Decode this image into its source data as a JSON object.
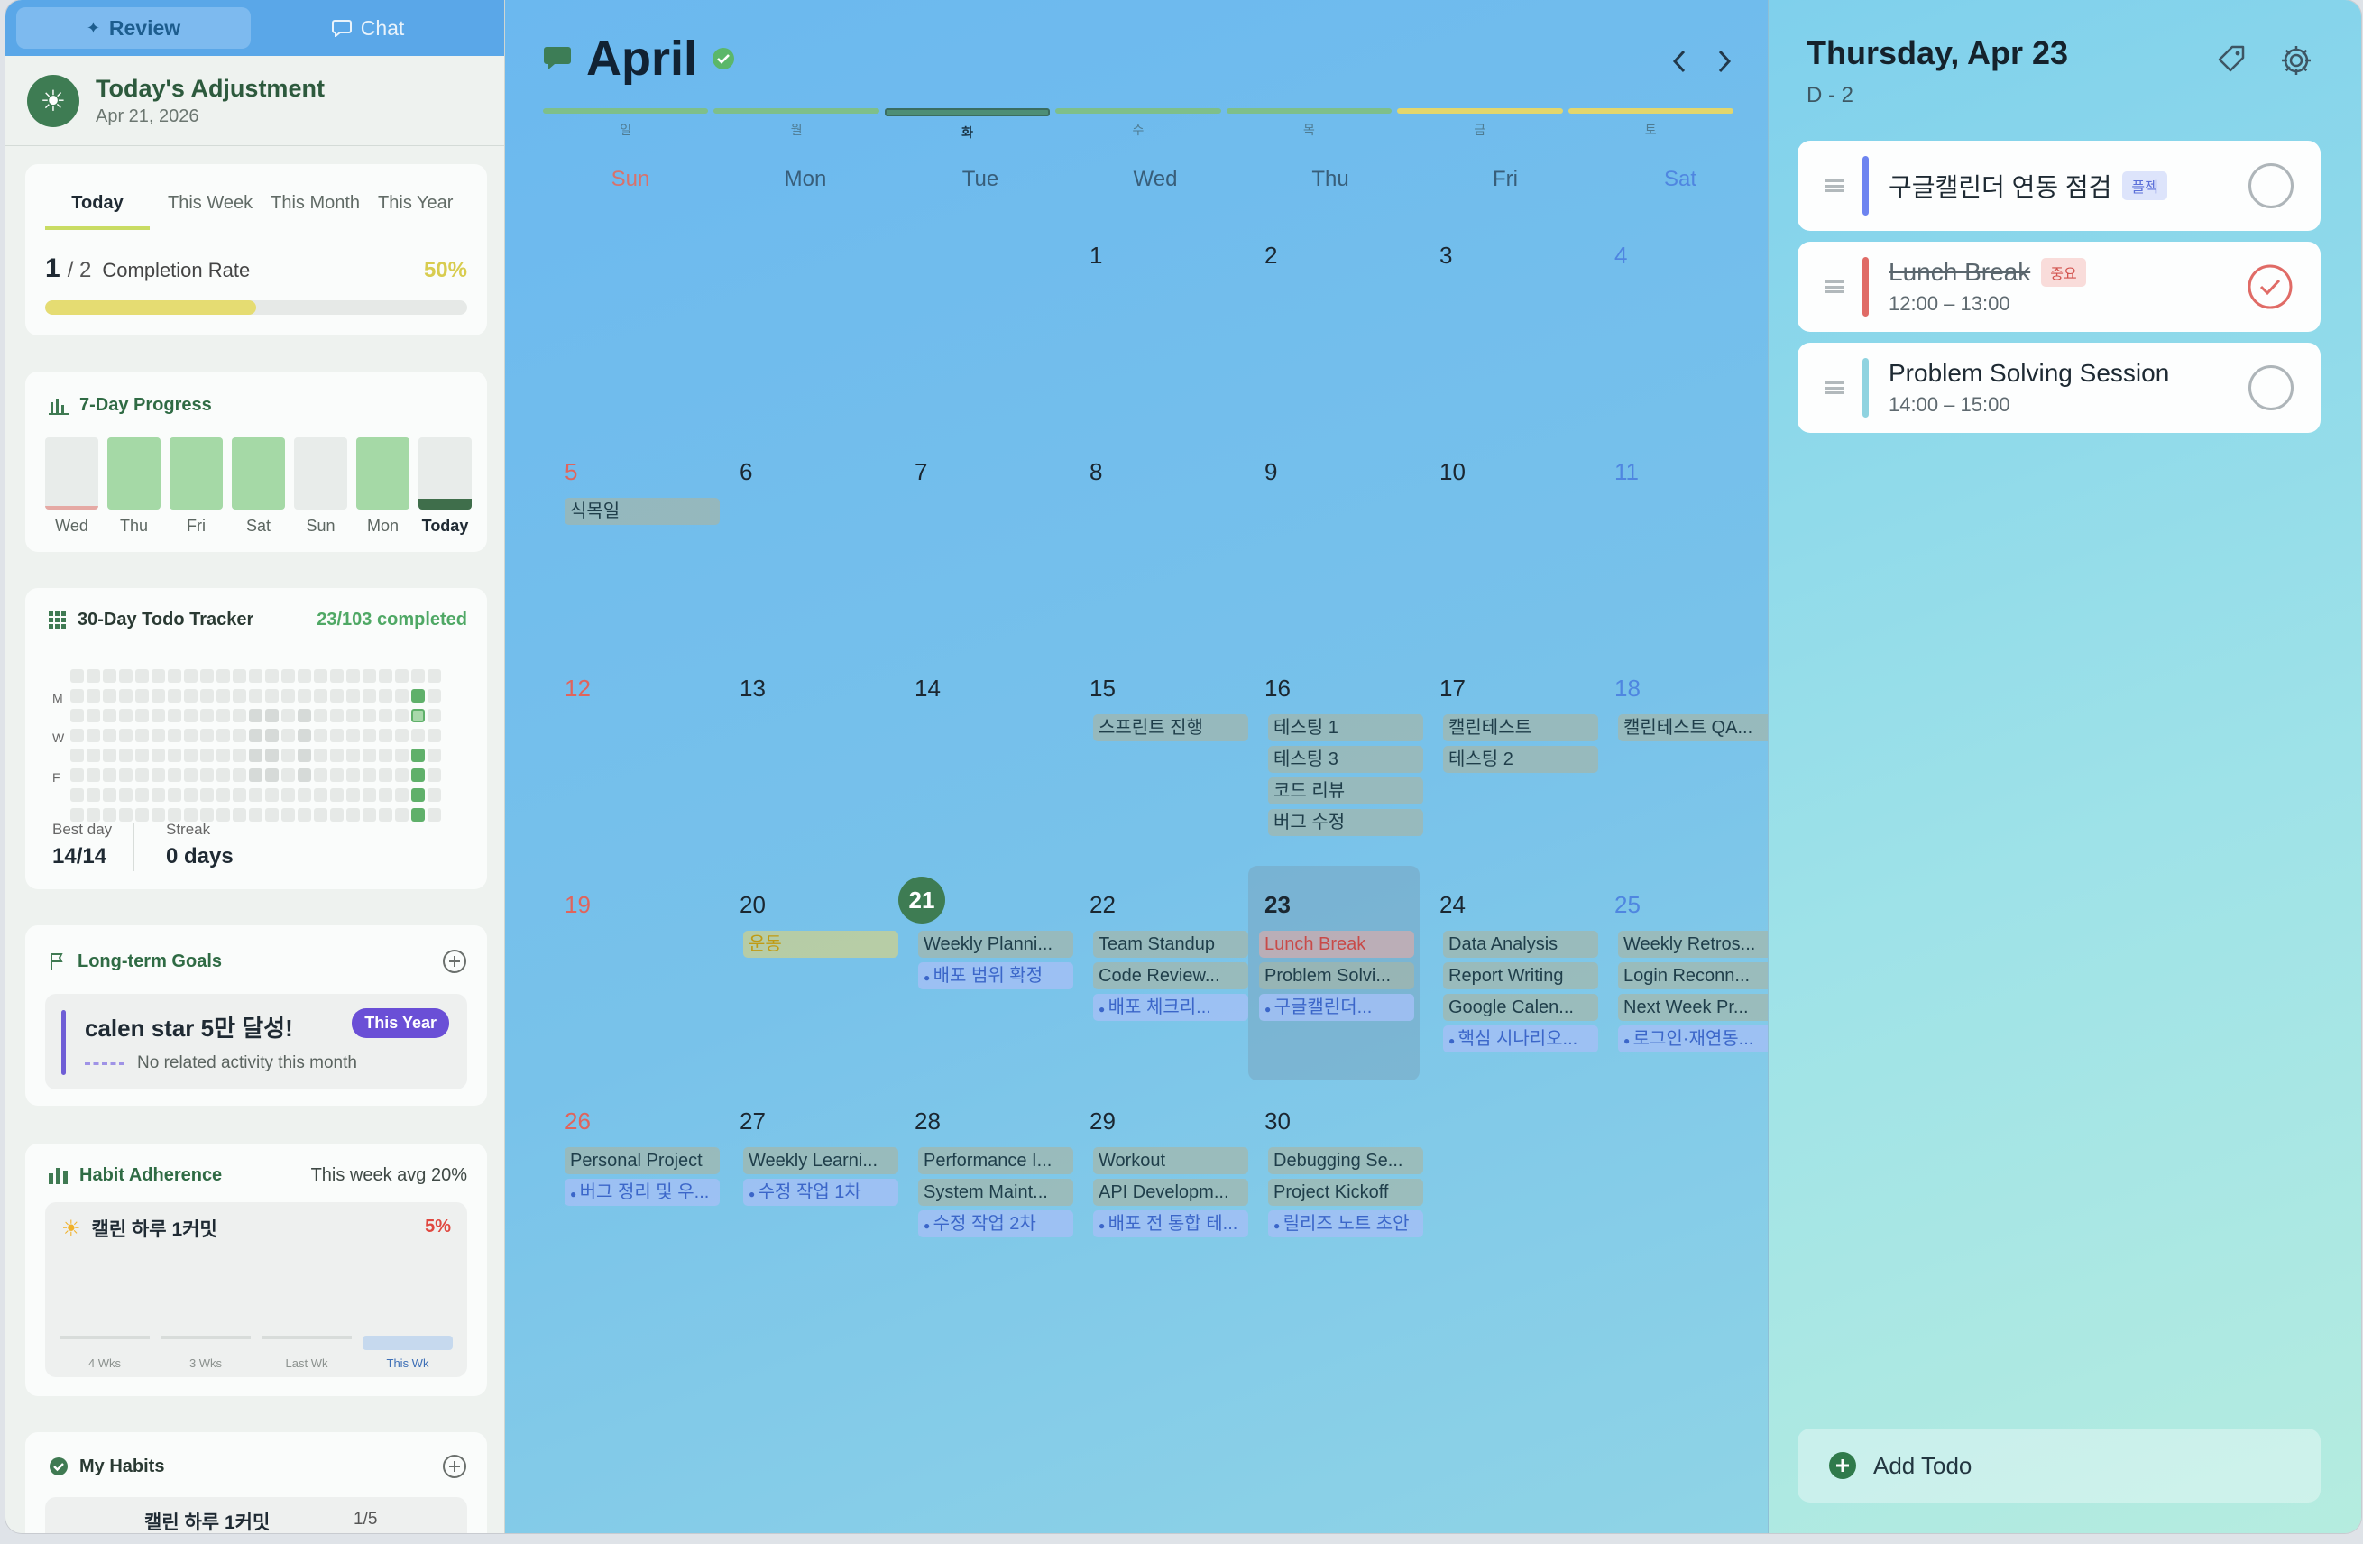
{
  "tabs": [
    {
      "label": "Review",
      "active": true
    },
    {
      "label": "Chat",
      "active": false
    }
  ],
  "adjustment": {
    "title": "Today's Adjustment",
    "date": "Apr 21, 2026"
  },
  "completion": {
    "periods": [
      "Today",
      "This Week",
      "This Month",
      "This Year"
    ],
    "selected": "Today",
    "done": "1",
    "sep": "/ 2",
    "label": "Completion Rate",
    "percent": "50%",
    "fraction": 0.5
  },
  "seven_day": {
    "title": "7-Day Progress",
    "days": [
      {
        "label": "Wed",
        "level": 0.05,
        "color": "#e5a9a4"
      },
      {
        "label": "Thu",
        "level": 1.0,
        "color": "#a5d9a6"
      },
      {
        "label": "Fri",
        "level": 1.0,
        "color": "#a5d9a6"
      },
      {
        "label": "Sat",
        "level": 1.0,
        "color": "#a5d9a6"
      },
      {
        "label": "Sun",
        "level": 0.0,
        "color": "#a5d9a6"
      },
      {
        "label": "Mon",
        "level": 1.0,
        "color": "#a5d9a6"
      },
      {
        "label": "Today",
        "level": 0.15,
        "color": "#3f6e4b"
      }
    ]
  },
  "tracker": {
    "title": "30-Day Todo Tracker",
    "summary": "23/103 completed",
    "row_labels": [
      "M",
      "W",
      "F"
    ],
    "best_day_label": "Best day",
    "best_day": "14/14",
    "streak_label": "Streak",
    "streak": "0 days"
  },
  "goals": {
    "title": "Long-term Goals",
    "item": {
      "name": "calen star 5만 달성!",
      "badge": "This Year",
      "note": "No related activity this month"
    }
  },
  "habit": {
    "title": "Habit Adherence",
    "avg": "This week avg 20%",
    "name": "캘린 하루 1커밋",
    "percent": "5%",
    "weeks": [
      "4 Wks",
      "3 Wks",
      "Last Wk",
      "This Wk"
    ]
  },
  "my_habits": {
    "title": "My Habits",
    "item": "캘린 하루 1커밋",
    "count": "1/5"
  },
  "calendar": {
    "month": "April",
    "week_strip": [
      "일",
      "월",
      "화",
      "수",
      "목",
      "금",
      "토"
    ],
    "dow": [
      "Sun",
      "Mon",
      "Tue",
      "Wed",
      "Thu",
      "Fri",
      "Sat"
    ],
    "weeks": [
      [
        null,
        null,
        null,
        {
          "d": "1"
        },
        {
          "d": "2"
        },
        {
          "d": "3"
        },
        {
          "d": "4"
        }
      ],
      [
        {
          "d": "5",
          "ev": [
            {
              "t": "식목일",
              "k": ""
            }
          ]
        },
        {
          "d": "6"
        },
        {
          "d": "7"
        },
        {
          "d": "8"
        },
        {
          "d": "9"
        },
        {
          "d": "10"
        },
        {
          "d": "11"
        }
      ],
      [
        {
          "d": "12"
        },
        {
          "d": "13"
        },
        {
          "d": "14"
        },
        {
          "d": "15",
          "ev": [
            {
              "t": "스프린트 진행",
              "k": ""
            }
          ]
        },
        {
          "d": "16",
          "ev": [
            {
              "t": "테스팅 1",
              "k": ""
            },
            {
              "t": "테스팅 3",
              "k": ""
            },
            {
              "t": "코드 리뷰",
              "k": ""
            },
            {
              "t": "버그 수정",
              "k": ""
            }
          ]
        },
        {
          "d": "17",
          "ev": [
            {
              "t": "캘린테스트",
              "k": ""
            },
            {
              "t": "테스팅 2",
              "k": ""
            }
          ]
        },
        {
          "d": "18",
          "ev": [
            {
              "t": "캘린테스트 QA...",
              "k": ""
            }
          ]
        }
      ],
      [
        {
          "d": "19"
        },
        {
          "d": "20",
          "ev": [
            {
              "t": "운동",
              "k": "yel"
            }
          ]
        },
        {
          "d": "21",
          "today": true,
          "ev": [
            {
              "t": "Weekly Planni...",
              "k": ""
            },
            {
              "t": "배포 범위 확정",
              "k": "sub"
            }
          ]
        },
        {
          "d": "22",
          "ev": [
            {
              "t": "Team Standup",
              "k": ""
            },
            {
              "t": "Code Review...",
              "k": ""
            },
            {
              "t": "배포 체크리...",
              "k": "sub"
            }
          ]
        },
        {
          "d": "23",
          "sel": true,
          "ev": [
            {
              "t": "Lunch Break",
              "k": "red"
            },
            {
              "t": "Problem Solvi...",
              "k": ""
            },
            {
              "t": "구글캘린더...",
              "k": "sub"
            }
          ]
        },
        {
          "d": "24",
          "ev": [
            {
              "t": "Data Analysis",
              "k": ""
            },
            {
              "t": "Report Writing",
              "k": ""
            },
            {
              "t": "Google Calen...",
              "k": ""
            },
            {
              "t": "핵심 시나리오...",
              "k": "sub"
            }
          ]
        },
        {
          "d": "25",
          "ev": [
            {
              "t": "Weekly Retros...",
              "k": ""
            },
            {
              "t": "Login Reconn...",
              "k": ""
            },
            {
              "t": "Next Week Pr...",
              "k": ""
            },
            {
              "t": "로그인·재연동...",
              "k": "sub"
            }
          ]
        }
      ],
      [
        {
          "d": "26",
          "ev": [
            {
              "t": "Personal Project",
              "k": ""
            },
            {
              "t": "버그 정리 및 우...",
              "k": "sub"
            }
          ]
        },
        {
          "d": "27",
          "ev": [
            {
              "t": "Weekly Learni...",
              "k": ""
            },
            {
              "t": "수정 작업 1차",
              "k": "sub"
            }
          ]
        },
        {
          "d": "28",
          "ev": [
            {
              "t": "Performance I...",
              "k": ""
            },
            {
              "t": "System Maint...",
              "k": ""
            },
            {
              "t": "수정 작업 2차",
              "k": "sub"
            }
          ]
        },
        {
          "d": "29",
          "ev": [
            {
              "t": "Workout",
              "k": ""
            },
            {
              "t": "API Developm...",
              "k": ""
            },
            {
              "t": "배포 전 통합 테...",
              "k": "sub"
            }
          ]
        },
        {
          "d": "30",
          "ev": [
            {
              "t": "Debugging Se...",
              "k": ""
            },
            {
              "t": "Project Kickoff",
              "k": ""
            },
            {
              "t": "릴리즈 노트 초안",
              "k": "sub"
            }
          ]
        },
        null,
        null
      ]
    ]
  },
  "panel": {
    "title": "Thursday, Apr 23",
    "dday": "D - 2",
    "todos": [
      {
        "title": "구글캘린더 연동 점검",
        "tag": "플젝",
        "time": "",
        "done": false,
        "color": "#6d84f0",
        "tag_bg": "#dde4fb",
        "tag_fg": "#5b6fd8"
      },
      {
        "title": "Lunch Break",
        "tag": "중요",
        "time": "12:00 – 13:00",
        "done": true,
        "color": "#e06b66",
        "tag_bg": "#f9dcda",
        "tag_fg": "#d2524d"
      },
      {
        "title": "Problem Solving Session",
        "tag": "",
        "time": "14:00 – 15:00",
        "done": false,
        "color": "#8fd3e0",
        "tag_bg": "",
        "tag_fg": ""
      }
    ],
    "add_label": "Add Todo"
  }
}
